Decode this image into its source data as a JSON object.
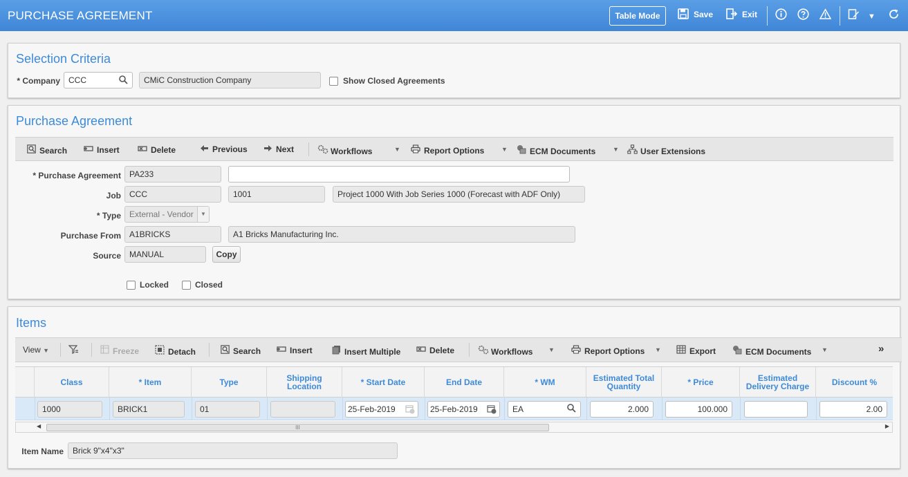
{
  "header": {
    "title": "PURCHASE AGREEMENT",
    "table_mode": "Table Mode",
    "save": "Save",
    "exit": "Exit"
  },
  "selection": {
    "title": "Selection Criteria",
    "company_label": "* Company",
    "company_code": "CCC",
    "company_name": "CMiC Construction Company",
    "show_closed_label": "Show Closed Agreements"
  },
  "pa": {
    "title": "Purchase Agreement",
    "toolbar": {
      "search": "Search",
      "insert": "Insert",
      "delete": "Delete",
      "previous": "Previous",
      "next": "Next",
      "workflows": "Workflows",
      "report_options": "Report Options",
      "ecm_documents": "ECM Documents",
      "user_extensions": "User Extensions"
    },
    "labels": {
      "purchase_agreement": "* Purchase Agreement",
      "job": "Job",
      "type": "* Type",
      "purchase_from": "Purchase From",
      "source": "Source",
      "locked": "Locked",
      "closed": "Closed",
      "copy": "Copy"
    },
    "values": {
      "purchase_agreement": "PA233",
      "description": "",
      "job_company": "CCC",
      "job_code": "1001",
      "job_name": "Project 1000 With Job Series 1000 (Forecast with ADF Only)",
      "type": "External - Vendor",
      "vendor_code": "A1BRICKS",
      "vendor_name": "A1 Bricks Manufacturing Inc.",
      "source": "MANUAL"
    }
  },
  "items": {
    "title": "Items",
    "toolbar": {
      "view": "View",
      "freeze": "Freeze",
      "detach": "Detach",
      "search": "Search",
      "insert": "Insert",
      "insert_multiple": "Insert Multiple",
      "delete": "Delete",
      "workflows": "Workflows",
      "report_options": "Report Options",
      "export": "Export",
      "ecm_documents": "ECM Documents",
      "more": "»"
    },
    "columns": {
      "class": "Class",
      "item": "* Item",
      "type": "Type",
      "shipping_location": "Shipping Location",
      "start_date": "* Start Date",
      "end_date": "End Date",
      "wm": "* WM",
      "est_total_qty": "Estimated Total Quantity",
      "price": "* Price",
      "est_delivery_charge": "Estimated Delivery Charge",
      "discount": "Discount %"
    },
    "row": {
      "class": "1000",
      "item": "BRICK1",
      "type": "01",
      "shipping_location": "",
      "start_date": "25-Feb-2019",
      "end_date": "25-Feb-2019",
      "wm": "EA",
      "est_total_qty": "2.000",
      "price": "100.000",
      "est_delivery_charge": "",
      "discount": "2.00"
    },
    "item_name_label": "Item Name",
    "item_name": "Brick 9\"x4\"x3\""
  }
}
